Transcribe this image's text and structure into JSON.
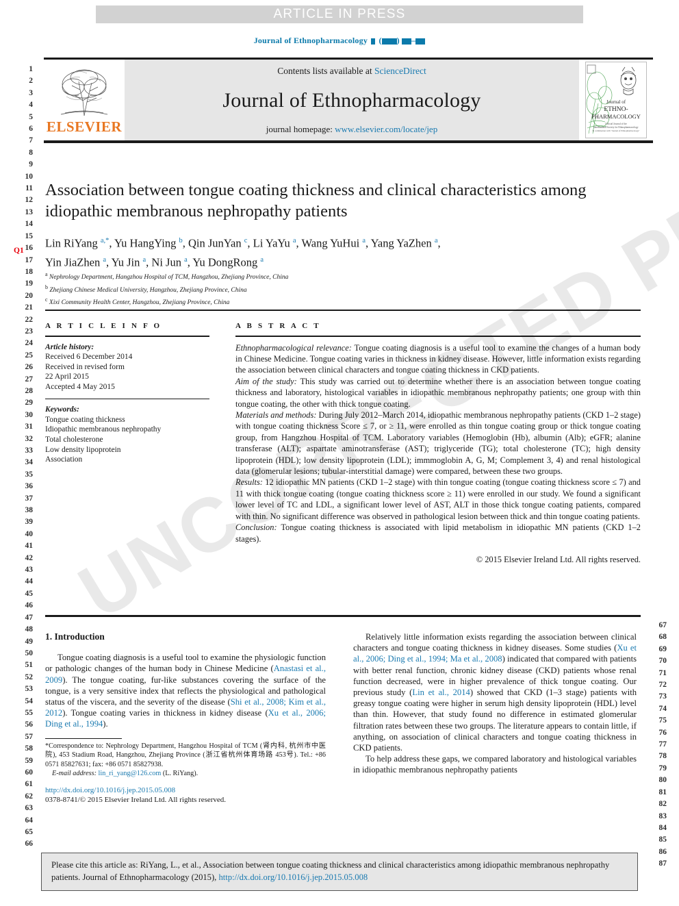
{
  "banner": {
    "text": "ARTICLE IN PRESS"
  },
  "running_head": {
    "journal": "Journal of Ethnopharmacology"
  },
  "masthead": {
    "contents_prefix": "Contents lists available at ",
    "contents_link": "ScienceDirect",
    "journal_title": "Journal of Ethnopharmacology",
    "homepage_prefix": "journal homepage: ",
    "homepage_link": "www.elsevier.com/locate/jep",
    "publisher": "ELSEVIER",
    "cover_lines": [
      "Journal of",
      "ETHNO-",
      "PHARMACOLOGY"
    ]
  },
  "article": {
    "title": "Association between tongue coating thickness and clinical characteristics among idiopathic membranous nephropathy patients",
    "authors_line1": "Lin RiYang <sup>a,*</sup>, Yu HangYing <sup>b</sup>, Qin JunYan <sup>c</sup>, Li YaYu <sup>a</sup>, Wang YuHui <sup>a</sup>, Yang YaZhen <sup>a</sup>,",
    "authors_line2": "Yin JiaZhen <sup>a</sup>, Yu Jin <sup>a</sup>, Ni Jun <sup>a</sup>, Yu DongRong <sup>a</sup>",
    "affiliations": [
      {
        "mark": "a",
        "text": "Nephrology Department, Hangzhou Hospital of TCM, Hangzhou, Zhejiang Province, China"
      },
      {
        "mark": "b",
        "text": "Zhejiang Chinese Medical University, Hangzhou, Zhejiang Province, China"
      },
      {
        "mark": "c",
        "text": "Xixi Community Health Center, Hangzhou, Zhejiang Province, China"
      }
    ]
  },
  "article_info": {
    "heading": "A R T I C L E   I N F O",
    "history_label": "Article history:",
    "history": [
      "Received 6 December 2014",
      "Received in revised form",
      "22 April 2015",
      "Accepted 4 May 2015"
    ],
    "keywords_label": "Keywords:",
    "keywords": [
      "Tongue coating thickness",
      "Idiopathic membranous nephropathy",
      "Total cholesterone",
      "Low density lipoprotein",
      "Association"
    ]
  },
  "abstract": {
    "heading": "A B S T R A C T",
    "sections": [
      {
        "label": "Ethnopharmacological relevance:",
        "text": " Tongue coating diagnosis is a useful tool to examine the changes of a human body in Chinese Medicine. Tongue coating varies in thickness in kidney disease. However, little information exists regarding the association between clinical characters and tongue coating thickness in CKD patients."
      },
      {
        "label": "Aim of the study:",
        "text": " This study was carried out to determine whether there is an association between tongue coating thickness and laboratory, histological variables in idiopathic membranous nephropathy patients; one group with thin tongue coating, the other with thick tongue coating."
      },
      {
        "label": "Materials and methods:",
        "text": " During July 2012–March 2014, idiopathic membranous nephropathy patients (CKD 1–2 stage) with tongue coating thickness Score ≤ 7, or ≥ 11, were enrolled as thin tongue coating group or thick tongue coating group, from Hangzhou Hospital of TCM. Laboratory variables (Hemoglobin (Hb), albumin (Alb); eGFR; alanine transferase (ALT); aspartate aminotransferase (AST); triglyceride (TG); total cholesterone (TC); high density lipoprotein (HDL); low density lipoprotein (LDL); immmoglobin A, G, M; Complement 3, 4) and renal histological data (glomerular lesions; tubular-interstitial damage) were compared, between these two groups."
      },
      {
        "label": "Results:",
        "text": " 12 idiopathic MN patients (CKD 1–2 stage) with thin tongue coating (tongue coating thickness score ≤ 7) and 11 with thick tongue coating (tongue coating thickness score ≥ 11) were enrolled in our study. We found a significant lower level of TC and LDL, a significant lower level of AST, ALT in those thick tongue coating patients, compared with thin. No significant difference was observed in pathological lesion between thick and thin tongue coating patients."
      },
      {
        "label": "Conclusion:",
        "text": " Tongue coating thickness is associated with lipid metabolism in idiopathic MN patients (CKD 1–2 stages)."
      }
    ],
    "copyright": "© 2015 Elsevier Ireland Ltd. All rights reserved."
  },
  "introduction": {
    "heading": "1.  Introduction",
    "left_paragraphs": [
      {
        "parts": [
          {
            "t": "Tongue coating diagnosis is a useful tool to examine the physiologic function or pathologic changes of the human body in Chinese Medicine ("
          },
          {
            "t": "Anastasi et al., 2009",
            "ref": true
          },
          {
            "t": "). The tongue coating, fur-like substances covering the surface of the tongue, is a very sensitive index that reflects the physiological and pathological status of the viscera, and the severity of the disease ("
          },
          {
            "t": "Shi et al., 2008; Kim et al., 2012",
            "ref": true
          },
          {
            "t": "). Tongue coating varies in thickness in kidney disease ("
          },
          {
            "t": "Xu et al., 2006; Ding et al., 1994",
            "ref": true
          },
          {
            "t": ")."
          }
        ]
      }
    ],
    "right_paragraphs": [
      {
        "parts": [
          {
            "t": "Relatively little information exists regarding the association between clinical characters and tongue coating thickness in kidney diseases. Some studies ("
          },
          {
            "t": "Xu et al., 2006; Ding et al., 1994; Ma et al., 2008",
            "ref": true
          },
          {
            "t": ") indicated that compared with patients with better renal function, chronic kidney disease (CKD) patients whose renal function decreased, were in higher prevalence of thick tongue coating. Our previous study ("
          },
          {
            "t": "Lin et al., 2014",
            "ref": true
          },
          {
            "t": ") showed that CKD (1–3 stage) patients with greasy tongue coating were higher in serum high density lipoprotein (HDL) level than thin. However, that study found no difference in estimated glomerular filtration rates between these two groups. The literature appears to contain little, if anything, on association of clinical characters and tongue coating thickness in CKD patients."
          }
        ]
      },
      {
        "parts": [
          {
            "t": "To help address these gaps, we compared laboratory and histological variables in idiopathic membranous nephropathy patients"
          }
        ]
      }
    ]
  },
  "footnote": {
    "correspondence": "Correspondence to: Nephrology Department, Hangzhou Hospital of TCM (肾内科, 杭州市中医院), 453 Stadium Road, Hangzhou, Zhejiang Province (浙江省杭州体育场路 453号). Tel.: +86 0571 85827631; fax: +86 0571 85827938.",
    "email_label": "E-mail address: ",
    "email": "lin_ri_yang@126.com",
    "email_suffix": " (L. RiYang)."
  },
  "doi": {
    "url": "http://dx.doi.org/10.1016/j.jep.2015.05.008",
    "issn_line": "0378-8741/© 2015 Elsevier Ireland Ltd. All rights reserved."
  },
  "citation_box": {
    "text_before": "Please cite this article as: RiYang, L., et al., Association between tongue coating thickness and clinical characteristics among idiopathic membranous nephropathy patients. Journal of Ethnopharmacology (2015), ",
    "link": "http://dx.doi.org/10.1016/j.jep.2015.05.008"
  },
  "line_numbers": {
    "left_start": 1,
    "left_end": 66,
    "right_start": 67,
    "right_end": 87,
    "query_marker": "Q1"
  },
  "watermark": {
    "text": "UNCORRECTED PROOF"
  },
  "colors": {
    "link": "#1a7ab0",
    "elsevier_orange": "#e87722",
    "banner_bg": "#d2d2d2",
    "masthead_bg": "#e6e6e6",
    "query_red": "#e8000b"
  }
}
